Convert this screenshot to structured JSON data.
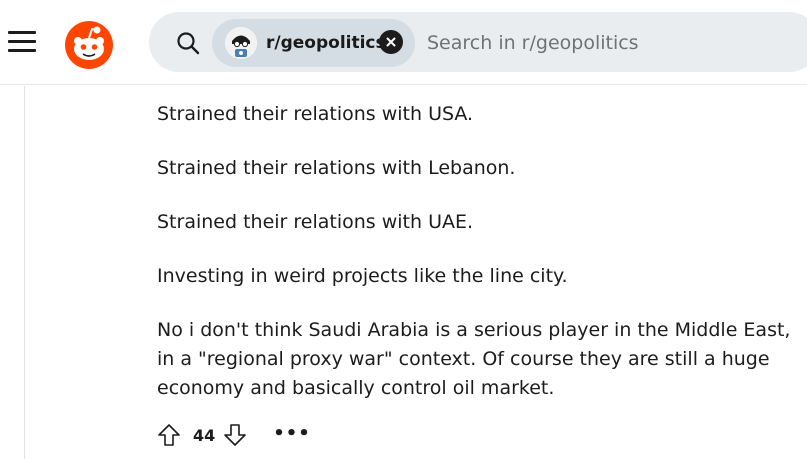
{
  "header": {
    "menu_icon": "hamburger-menu-icon",
    "logo_icon": "reddit-logo-icon",
    "brand_color": "#ff4500",
    "search": {
      "icon": "search-icon",
      "community_chip": {
        "label": "r/geopolitics",
        "avatar_icon": "subreddit-avatar-icon",
        "close_icon": "close-icon"
      },
      "placeholder": "Search in r/geopolitics",
      "value": ""
    }
  },
  "comment": {
    "paragraphs": [
      "Strained their relations with USA.",
      "Strained their relations with Lebanon.",
      "Strained their relations with UAE.",
      "Investing in weird projects like the line city.",
      "No i don't think Saudi Arabia is a serious player in the Middle East, in a \"regional proxy war\" context. Of course they are still a huge economy and basically control oil market."
    ],
    "actions": {
      "upvote_icon": "upvote-arrow-icon",
      "score": "44",
      "downvote_icon": "downvote-arrow-icon",
      "more_label": "•••",
      "more_icon": "more-options-icon"
    }
  }
}
